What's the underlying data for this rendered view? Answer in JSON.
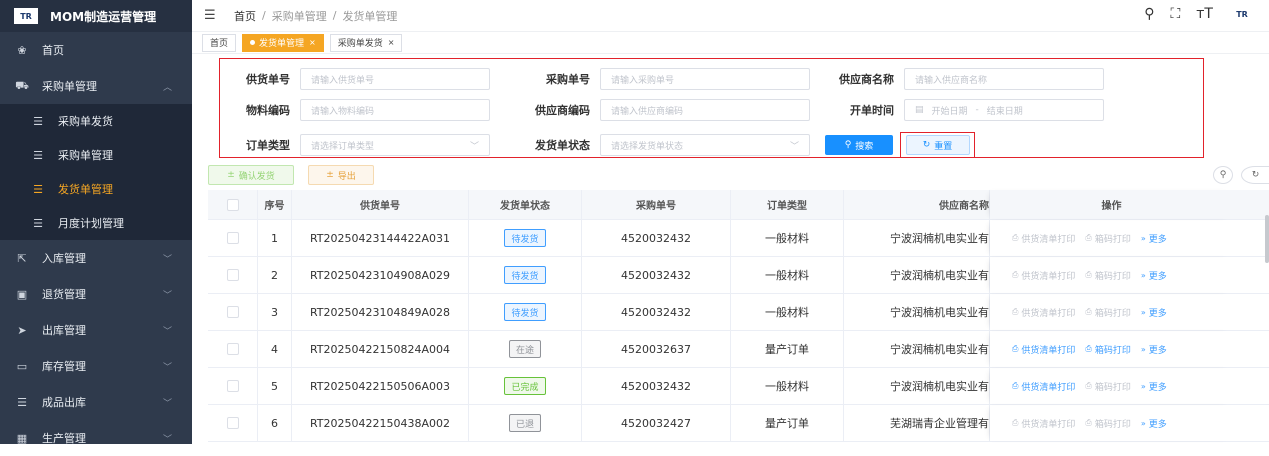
{
  "brand": {
    "logo": "TR",
    "title": "MOM制造运营管理"
  },
  "sidebar": {
    "items": [
      {
        "label": "首页",
        "icon": "dashboard-icon",
        "glyph": "❀"
      },
      {
        "label": "采购单管理",
        "icon": "cart-icon",
        "glyph": "⛟",
        "expanded": true
      },
      {
        "label": "采购单发货",
        "icon": "list-icon",
        "glyph": "☰",
        "sub": true
      },
      {
        "label": "采购单管理",
        "icon": "list-icon",
        "glyph": "☰",
        "sub": true
      },
      {
        "label": "发货单管理",
        "icon": "list-icon",
        "glyph": "☰",
        "sub": true,
        "active": true
      },
      {
        "label": "月度计划管理",
        "icon": "list-icon",
        "glyph": "☰",
        "sub": true
      },
      {
        "label": "入库管理",
        "icon": "inbound-icon",
        "glyph": "⇱",
        "collapsed": true
      },
      {
        "label": "退货管理",
        "icon": "return-icon",
        "glyph": "▣",
        "collapsed": true
      },
      {
        "label": "出库管理",
        "icon": "send-icon",
        "glyph": "➤",
        "collapsed": true
      },
      {
        "label": "库存管理",
        "icon": "warehouse-icon",
        "glyph": "▭",
        "collapsed": true
      },
      {
        "label": "成品出库",
        "icon": "list-icon",
        "glyph": "☰",
        "collapsed": true
      },
      {
        "label": "生产管理",
        "icon": "production-icon",
        "glyph": "▦",
        "collapsed": true
      }
    ]
  },
  "header": {
    "breadcrumb": [
      "首页",
      "采购单管理",
      "发货单管理"
    ],
    "separator": "/",
    "logo": "TR"
  },
  "tabs": [
    {
      "label": "首页"
    },
    {
      "label": "发货单管理",
      "active": true,
      "close": "×"
    },
    {
      "label": "采购单发货",
      "close": "×"
    }
  ],
  "form": {
    "supplier_no": {
      "label": "供货单号",
      "placeholder": "请输入供货单号"
    },
    "po_no": {
      "label": "采购单号",
      "placeholder": "请输入采购单号"
    },
    "supplier_name": {
      "label": "供应商名称",
      "placeholder": "请输入供应商名称"
    },
    "material_code": {
      "label": "物料编码",
      "placeholder": "请输入物料编码"
    },
    "supplier_code": {
      "label": "供应商编码",
      "placeholder": "请输入供应商编码"
    },
    "open_time": {
      "label": "开单时间",
      "start": "开始日期",
      "dash": "-",
      "end": "结束日期"
    },
    "order_type": {
      "label": "订单类型",
      "placeholder": "请选择订单类型"
    },
    "ship_status": {
      "label": "发货单状态",
      "placeholder": "请选择发货单状态"
    },
    "search_btn": "搜索",
    "reset_btn": "重置"
  },
  "actions": {
    "confirm": "确认发货",
    "export": "导出"
  },
  "table": {
    "columns": [
      "序号",
      "供货单号",
      "发货单状态",
      "采购单号",
      "订单类型",
      "供应商名称",
      "操作"
    ],
    "op_labels": {
      "print_list": "供货清单打印",
      "print_box": "箱码打印",
      "more": "更多"
    },
    "rows": [
      {
        "idx": "1",
        "no": "RT20250423144422A031",
        "status": "待发货",
        "status_color": "blue",
        "po": "4520032432",
        "type": "一般材料",
        "supplier": "宁波润楠机电实业有",
        "print_list_on": false,
        "print_box_on": false
      },
      {
        "idx": "2",
        "no": "RT20250423104908A029",
        "status": "待发货",
        "status_color": "blue",
        "po": "4520032432",
        "type": "一般材料",
        "supplier": "宁波润楠机电实业有",
        "print_list_on": false,
        "print_box_on": false
      },
      {
        "idx": "3",
        "no": "RT20250423104849A028",
        "status": "待发货",
        "status_color": "blue",
        "po": "4520032432",
        "type": "一般材料",
        "supplier": "宁波润楠机电实业有",
        "print_list_on": false,
        "print_box_on": false
      },
      {
        "idx": "4",
        "no": "RT20250422150824A004",
        "status": "在途",
        "status_color": "gray",
        "po": "4520032637",
        "type": "量产订单",
        "supplier": "宁波润楠机电实业有",
        "print_list_on": true,
        "print_box_on": true
      },
      {
        "idx": "5",
        "no": "RT20250422150506A003",
        "status": "已完成",
        "status_color": "green",
        "po": "4520032432",
        "type": "一般材料",
        "supplier": "宁波润楠机电实业有",
        "print_list_on": true,
        "print_box_on": false
      },
      {
        "idx": "6",
        "no": "RT20250422150438A002",
        "status": "已退",
        "status_color": "gray",
        "po": "4520032427",
        "type": "量产订单",
        "supplier": "芜湖瑞青企业管理有",
        "print_list_on": false,
        "print_box_on": false
      }
    ]
  }
}
